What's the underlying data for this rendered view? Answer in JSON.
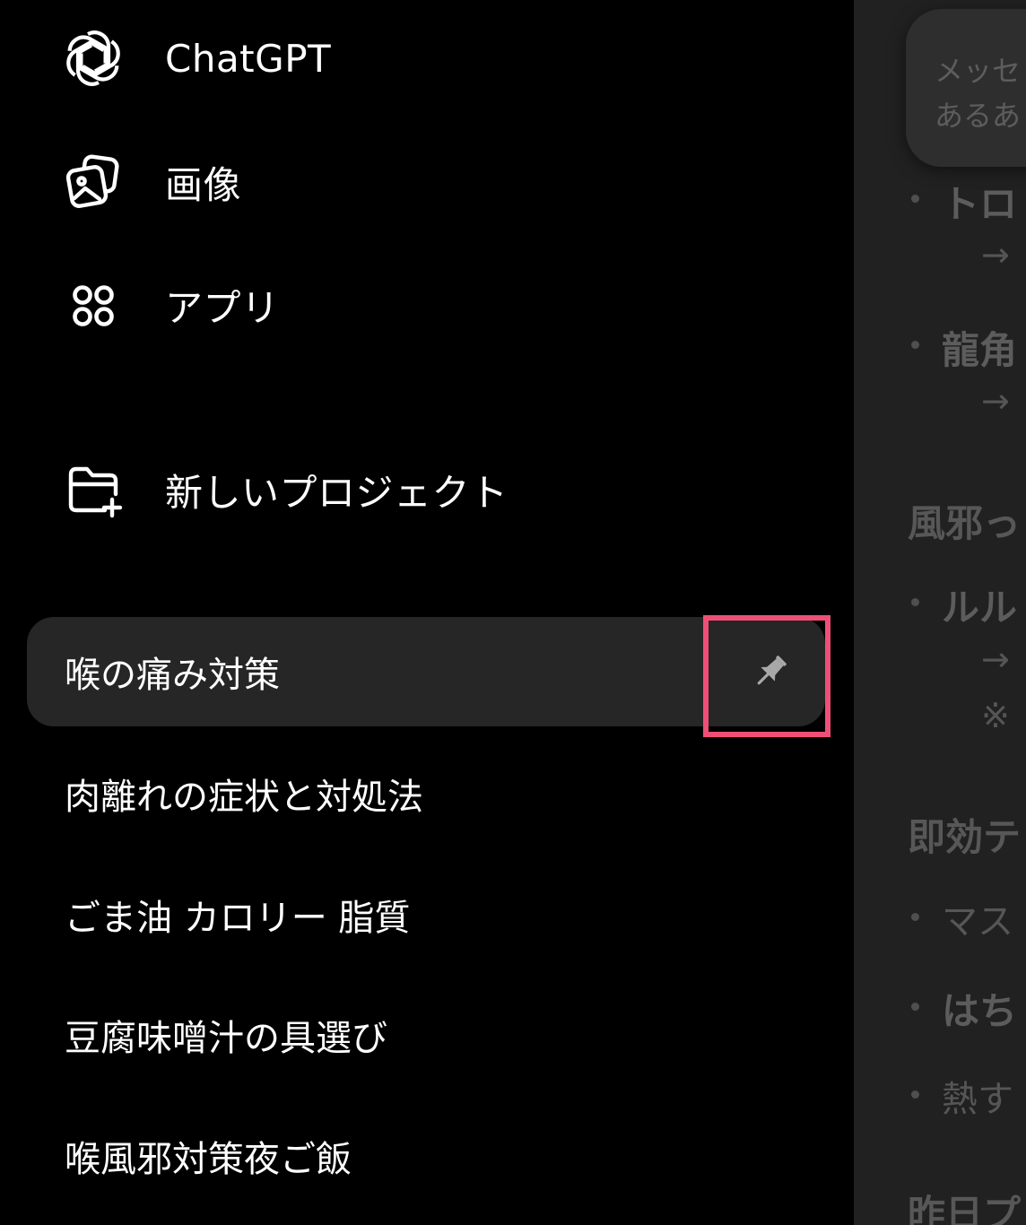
{
  "sidebar": {
    "nav": [
      {
        "label": "ChatGPT",
        "icon": "openai-logo-icon"
      },
      {
        "label": "画像",
        "icon": "images-icon"
      },
      {
        "label": "アプリ",
        "icon": "apps-grid-icon"
      },
      {
        "label": "新しいプロジェクト",
        "icon": "new-folder-icon"
      }
    ],
    "chats": [
      {
        "label": "喉の痛み対策",
        "pinned": true
      },
      {
        "label": "肉離れの症状と対処法"
      },
      {
        "label": "ごま油 カロリー 脂質"
      },
      {
        "label": "豆腐味噌汁の具選び"
      },
      {
        "label": "喉風邪対策夜ご飯"
      }
    ],
    "pin_icon": "pin-icon",
    "highlight_color": "#ef4f77"
  },
  "content": {
    "bubble_line_1": "メッセ",
    "bubble_line_2": "あるあ",
    "lines": [
      "トロ",
      "→",
      "龍角",
      "→",
      "風邪っ",
      "ルル",
      "→",
      "※",
      "即効テ",
      "マス",
      "はち",
      "熱す",
      "昨日プ"
    ]
  }
}
